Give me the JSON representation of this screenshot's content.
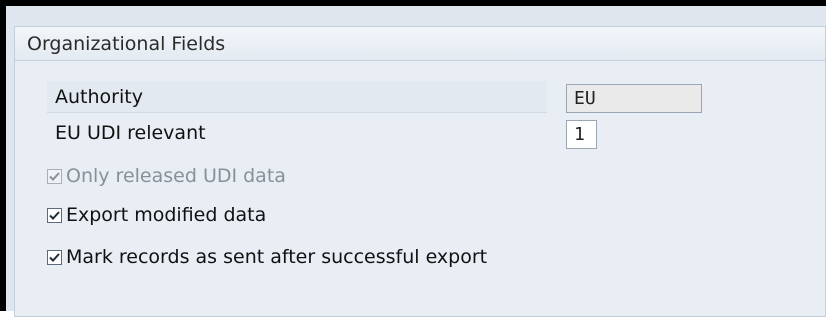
{
  "group": {
    "title": "Organizational Fields"
  },
  "fields": {
    "authority": {
      "label": "Authority",
      "value": "EU"
    },
    "eu_udi_relevant": {
      "label": "EU UDI relevant",
      "value": "1"
    }
  },
  "checkboxes": [
    {
      "label": "Only released UDI data",
      "checked": true,
      "enabled": false
    },
    {
      "label": "Export modified data",
      "checked": true,
      "enabled": true
    },
    {
      "label": "Mark records as sent after successful export",
      "checked": true,
      "enabled": true
    }
  ],
  "icons": {
    "checkbox": "check-icon"
  },
  "colors": {
    "panel_background": "#e8eef4",
    "checkmark": "#1f2d3d",
    "disabled_text": "#8a9098"
  }
}
